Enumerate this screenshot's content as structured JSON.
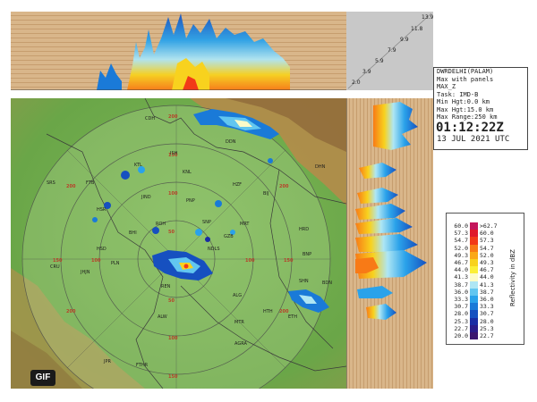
{
  "radar": {
    "station": "DWRDELHI(PALAM)",
    "mode": "Max with panels",
    "product": "MAX_Z",
    "task": "Task: IMD-B",
    "min_height": "Min Hgt:0.0 km",
    "max_height": "Max Hgt:15.0 km",
    "max_range": "Max Range:250 km",
    "time": "01:12:22Z",
    "date": "13 JUL 2021 UTC"
  },
  "badge": "GIF",
  "heights": [
    "13.9",
    "11.8",
    "9.9",
    "7.9",
    "5.9",
    "3.9",
    "2.0"
  ],
  "ring_labels": [
    "200",
    "150",
    "100",
    "50"
  ],
  "cities": [
    {
      "name": "KTL"
    },
    {
      "name": "KNL"
    },
    {
      "name": "HZF"
    },
    {
      "name": "BIJ"
    },
    {
      "name": "JIND"
    },
    {
      "name": "PNP"
    },
    {
      "name": "ROH"
    },
    {
      "name": "SNP"
    },
    {
      "name": "NDLS"
    },
    {
      "name": "GZB"
    },
    {
      "name": "MRT"
    },
    {
      "name": "HRD"
    },
    {
      "name": "BHI"
    },
    {
      "name": "HSR"
    },
    {
      "name": "FTB"
    },
    {
      "name": "SRS"
    },
    {
      "name": "CRU"
    },
    {
      "name": "JHJN"
    },
    {
      "name": "REN"
    },
    {
      "name": "ALW"
    },
    {
      "name": "MTR"
    },
    {
      "name": "ALG"
    },
    {
      "name": "HTH"
    },
    {
      "name": "AGRA"
    },
    {
      "name": "ETH"
    },
    {
      "name": "SHN"
    },
    {
      "name": "BDN"
    },
    {
      "name": "DHN"
    },
    {
      "name": "BNP"
    },
    {
      "name": "JPR"
    },
    {
      "name": "FTHR"
    },
    {
      "name": "CDH"
    },
    {
      "name": "ISH"
    },
    {
      "name": "DDN"
    },
    {
      "name": "HSD"
    },
    {
      "name": "PLN"
    }
  ],
  "legend": {
    "title": "Reflectivity in dBZ",
    "rows": [
      {
        "lo": "60.0",
        "hi": ">62.7",
        "color": "#c4165c"
      },
      {
        "lo": "57.3",
        "hi": "60.0",
        "color": "#e0182a"
      },
      {
        "lo": "54.7",
        "hi": "57.3",
        "color": "#f23a18"
      },
      {
        "lo": "52.0",
        "hi": "54.7",
        "color": "#f87a16"
      },
      {
        "lo": "49.3",
        "hi": "52.0",
        "color": "#faa818"
      },
      {
        "lo": "46.7",
        "hi": "49.3",
        "color": "#f8d21e"
      },
      {
        "lo": "44.0",
        "hi": "46.7",
        "color": "#fbef38"
      },
      {
        "lo": "41.3",
        "hi": "44.0",
        "color": "#fdfbc8"
      },
      {
        "lo": "38.7",
        "hi": "41.3",
        "color": "#aee6f4"
      },
      {
        "lo": "36.0",
        "hi": "38.7",
        "color": "#62c6f0"
      },
      {
        "lo": "33.3",
        "hi": "36.0",
        "color": "#2aa2ea"
      },
      {
        "lo": "30.7",
        "hi": "33.3",
        "color": "#1a7ad8"
      },
      {
        "lo": "28.0",
        "hi": "30.7",
        "color": "#1650c0"
      },
      {
        "lo": "25.3",
        "hi": "28.0",
        "color": "#1a2ca4"
      },
      {
        "lo": "22.7",
        "hi": "25.3",
        "color": "#2a1c8a"
      },
      {
        "lo": "20.0",
        "hi": "22.7",
        "color": "#3a1670"
      }
    ]
  },
  "colors": {
    "terrain": "#6fae4c",
    "panel": "#d9b68a",
    "ring": "#b8412a",
    "border": "#404040",
    "echo_low": "#1a2ca4",
    "echo_mid": "#2aa2ea",
    "echo_high": "#f8d21e",
    "echo_peak": "#f23a18"
  }
}
